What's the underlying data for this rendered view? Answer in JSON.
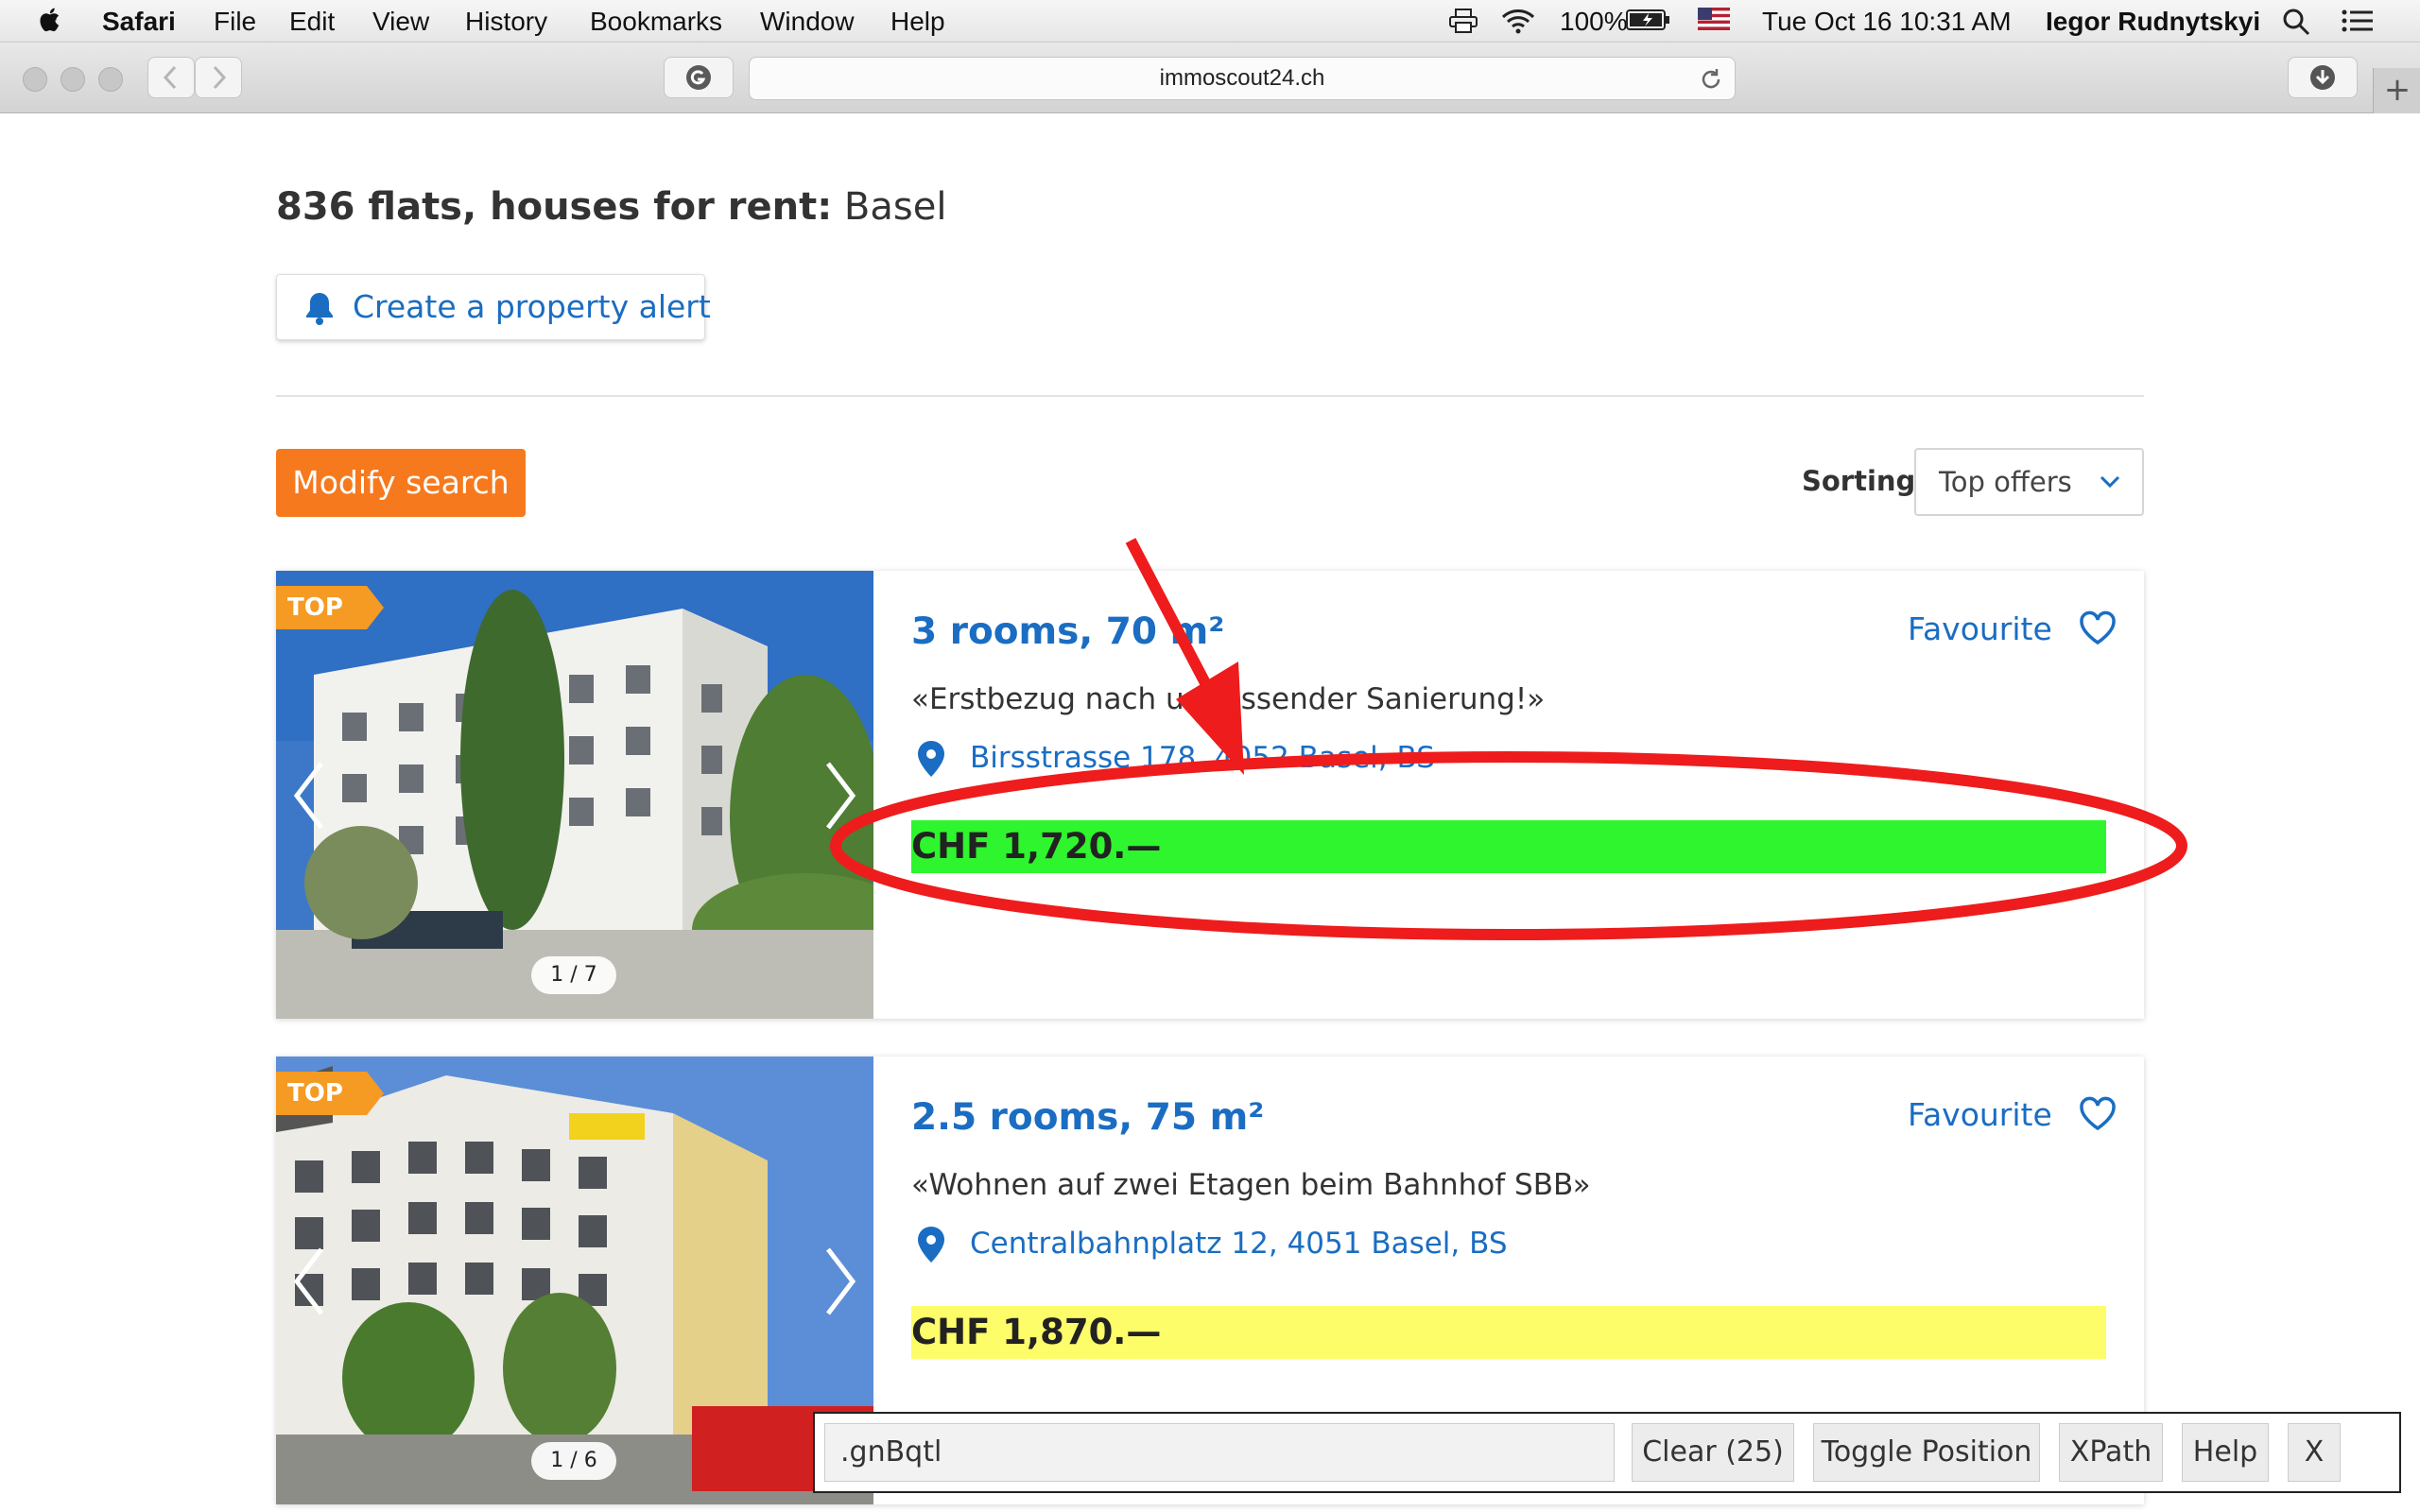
{
  "menubar": {
    "app": "Safari",
    "items": [
      "File",
      "Edit",
      "View",
      "History",
      "Bookmarks",
      "Window",
      "Help"
    ],
    "battery": "100%",
    "datetime": "Tue Oct 16  10:31 AM",
    "user": "Iegor Rudnytskyi"
  },
  "browser": {
    "url": "immoscout24.ch"
  },
  "page": {
    "count_bold": "836 flats, houses for rent:",
    "location": "Basel",
    "alert_button": "Create a property alert",
    "modify_button": "Modify search",
    "sorting_label": "Sorting",
    "sorting_value": "Top offers"
  },
  "listings": [
    {
      "badge": "TOP",
      "title": "3 rooms, 70 m²",
      "favourite": "Favourite",
      "description": "«Erstbezug nach umfassender Sanierung!»",
      "address": "Birsstrasse 178, 4052 Basel, BS",
      "price": "CHF 1,720.—",
      "price_highlight": "#2ef52e",
      "photo_counter": "1 / 7"
    },
    {
      "badge": "TOP",
      "title": "2.5 rooms, 75 m²",
      "favourite": "Favourite",
      "description": "«Wohnen auf zwei Etagen beim Bahnhof SBB»",
      "address": "Centralbahnplatz 12, 4051 Basel, BS",
      "price": "CHF 1,870.—",
      "price_highlight": "#fdfd6a",
      "photo_counter": "1 / 6"
    }
  ],
  "selector_gadget": {
    "selector": ".gnBqtl",
    "clear": "Clear (25)",
    "toggle": "Toggle Position",
    "xpath": "XPath",
    "help": "Help",
    "close": "X"
  },
  "colors": {
    "link_blue": "#1a6dc2",
    "accent_orange": "#f7791d",
    "badge_orange": "#f59a23",
    "annotation_red": "#ee1c1c"
  }
}
